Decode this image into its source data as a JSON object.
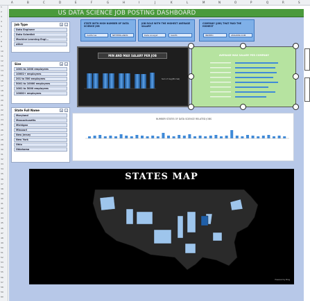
{
  "sheet": {
    "columns": [
      "A",
      "B",
      "C",
      "D",
      "E",
      "F",
      "G",
      "H",
      "I",
      "J",
      "K",
      "L",
      "M",
      "N",
      "O",
      "P",
      "Q",
      "R",
      "S"
    ],
    "rows": [
      "1",
      "2",
      "3",
      "4",
      "5",
      "6",
      "7",
      "8",
      "9",
      "10",
      "11",
      "12",
      "13",
      "14",
      "15",
      "16",
      "17",
      "18",
      "19",
      "20",
      "21",
      "22",
      "23",
      "24",
      "25",
      "26",
      "27",
      "28",
      "29",
      "30",
      "31",
      "32",
      "33",
      "34",
      "35",
      "36",
      "37",
      "38",
      "39",
      "40",
      "41",
      "42",
      "43",
      "44",
      "45",
      "46",
      "47",
      "48",
      "49",
      "50",
      "51",
      "52",
      "53",
      "54",
      "55",
      "56",
      "57",
      "58",
      "59",
      "60"
    ]
  },
  "dashboard": {
    "title": "US DATA SCIENCE JOB POSTING DASHBOARD"
  },
  "slicers": {
    "job_type": {
      "title": "Job Type",
      "items": [
        "Data Engineer",
        "Data Scientist",
        "Machine Learning Engi...",
        "other"
      ]
    },
    "size": {
      "title": "Size",
      "items": [
        "1001 to 1000 employees",
        "10001+ employees",
        "201 to 500 employees",
        "5001 to 10000 employees",
        "1001 to 5000 employees",
        "10000+ employees"
      ]
    },
    "state": {
      "title": "State Full Name",
      "items": [
        "Maryland",
        "Massachusetts",
        "Michigan",
        "Missouri",
        "New Jersey",
        "New York",
        "Ohio",
        "Oklahoma"
      ]
    }
  },
  "kpis": {
    "k1": {
      "label": "STATE WITH HIGH NUMBER OF DATA SCIENCE JOB",
      "values": [
        "California",
        "NETHERLANDS"
      ]
    },
    "k2": {
      "label": "JOB ROLE WITH THE HIGHEST AVERAGE SALARY",
      "values": [
        "Data Analyst",
        "SALES"
      ]
    },
    "k3": {
      "label": "COMPANY (JOB) THAT PAID THE HIGHEST",
      "values": [
        "INDEED",
        "AMAZON.COM"
      ]
    }
  },
  "charts": {
    "min_max": {
      "title": "MIN AND MAX SALARY PER JOB",
      "legend": "Sum of Avg(Min Sal)"
    },
    "avg_company": {
      "title": "AVERAGE MAX SALARY PER COMPANY"
    },
    "states_bar": {
      "title": "NUMBER STATES OF DATA SCIENCE RELATED JOBS"
    }
  },
  "map": {
    "title": "STATES MAP",
    "credit": "Powered by Bing"
  },
  "colors": {
    "title_bar": "#4a9a3c",
    "dashboard_bg": "#b7c8e8",
    "kpi": "#7fb0e8",
    "green_chart": "#b6e3a0",
    "bar_blue": "#3f8ad8"
  },
  "icons": [
    "multi-select-icon",
    "clear-filter-icon"
  ]
}
